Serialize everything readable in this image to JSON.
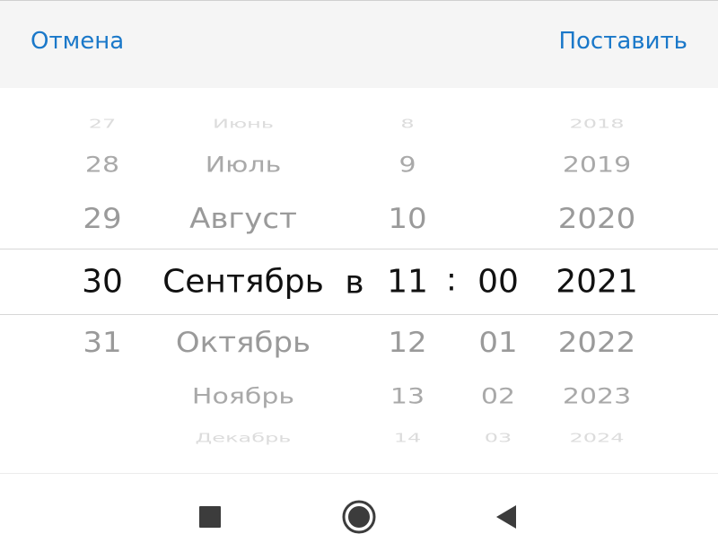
{
  "toolbar": {
    "cancel_label": "Отмена",
    "confirm_label": "Поставить"
  },
  "picker": {
    "days": [
      "27",
      "28",
      "29",
      "30",
      "31"
    ],
    "months": [
      "Июнь",
      "Июль",
      "Август",
      "Сентябрь",
      "Октябрь",
      "Ноябрь",
      "Декабрь"
    ],
    "connector": "в",
    "hours": [
      "8",
      "9",
      "10",
      "11",
      "12",
      "13",
      "14"
    ],
    "time_separator": ":",
    "minutes": [
      "00",
      "01",
      "02",
      "03"
    ],
    "years": [
      "2018",
      "2019",
      "2020",
      "2021",
      "2022",
      "2023",
      "2024"
    ],
    "selected": {
      "day": "30",
      "month": "Сентябрь",
      "hour": "11",
      "minute": "00",
      "year": "2021"
    }
  },
  "navbar": {
    "icons": [
      "recent-apps-icon",
      "home-icon",
      "back-icon"
    ]
  },
  "colors": {
    "accent": "#1a78c9",
    "selected_text": "#111111",
    "toolbar_bg": "#f5f5f5"
  }
}
